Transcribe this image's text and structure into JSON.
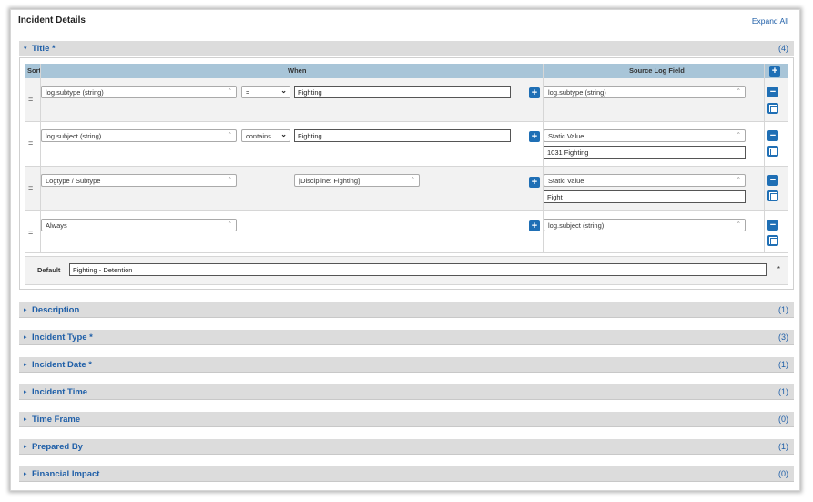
{
  "header": {
    "title": "Incident Details",
    "expand_all": "Expand All"
  },
  "title_section": {
    "arrow": "▾",
    "label": "Title *",
    "count": "(4)"
  },
  "grid": {
    "col_sort": "Sort",
    "col_when": "When",
    "col_source": "Source Log Field",
    "sort_glyph": "=",
    "rows": [
      {
        "field": "log.subtype (string)",
        "operator": "=",
        "value": "Fighting",
        "source": "log.subtype (string)",
        "static_value": ""
      },
      {
        "field": "log.subject (string)",
        "operator": "contains",
        "value": "Fighting",
        "source": "Static Value",
        "static_value": "1031 Fighting"
      },
      {
        "field": "Logtype / Subtype",
        "operator": "[Discipline: Fighting]",
        "value": "",
        "source": "Static Value",
        "static_value": "Fight"
      },
      {
        "field": "Always",
        "operator": "",
        "value": "",
        "source": "log.subject (string)",
        "static_value": ""
      }
    ],
    "default_label": "Default",
    "default_value": "Fighting - Detention",
    "default_star": "*"
  },
  "sections": [
    {
      "label": "Description",
      "count": "(1)"
    },
    {
      "label": "Incident Type *",
      "count": "(3)"
    },
    {
      "label": "Incident Date *",
      "count": "(1)"
    },
    {
      "label": "Incident Time",
      "count": "(1)"
    },
    {
      "label": "Time Frame",
      "count": "(0)"
    },
    {
      "label": "Prepared By",
      "count": "(1)"
    },
    {
      "label": "Financial Impact",
      "count": "(0)"
    }
  ],
  "collapsed_arrow": "▸",
  "icons": {
    "plus": "plus-icon",
    "minus": "minus-icon",
    "copy": "copy-icon",
    "caret": "chevron-down-icon"
  },
  "colors": {
    "accent": "#1f6fb5",
    "link": "#1f5fa8",
    "grid_header": "#a8c5d8",
    "section_bar": "#dcdcdc"
  }
}
